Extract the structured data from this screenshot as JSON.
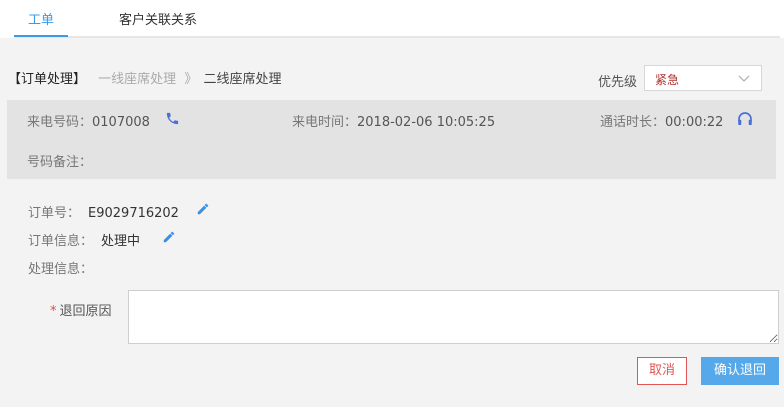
{
  "tabs": [
    {
      "label": "工单"
    },
    {
      "label": "客户关联关系"
    }
  ],
  "breadcrumb": {
    "title": "【订单处理】",
    "step1": "一线座席处理",
    "separator": "》",
    "step2": "二线座席处理"
  },
  "priority": {
    "label": "优先级",
    "value": "紧急"
  },
  "call_info": {
    "phone_label": "来电号码：",
    "phone_value": "0107008",
    "time_label": "来电时间：",
    "time_value": "2018-02-06 10:05:25",
    "duration_label": "通话时长：",
    "duration_value": "00:00:22",
    "note_label": "号码备注："
  },
  "order": {
    "number_label": "订单号：",
    "number_value": "E9029716202",
    "status_label": "订单信息：",
    "status_value": "处理中",
    "process_label": "处理信息："
  },
  "form": {
    "reason_label": "退回原因",
    "required_mark": "*",
    "reason_value": ""
  },
  "buttons": {
    "cancel": "取消",
    "confirm": "确认退回"
  },
  "colors": {
    "accent": "#3a9be8",
    "danger": "#e05555",
    "priority_text": "#b03030",
    "icon_blue": "#4a6fd8"
  },
  "icons": {
    "phone": "phone-icon",
    "headset": "headset-icon",
    "edit": "pencil-icon",
    "dropdown": "chevron-down-icon"
  }
}
